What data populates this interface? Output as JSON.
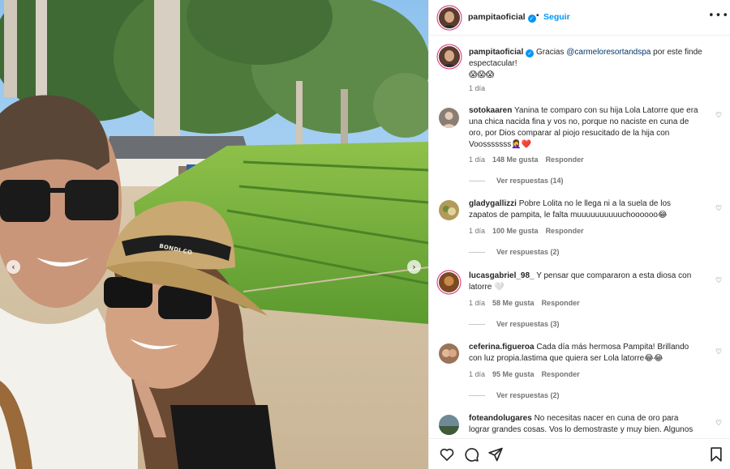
{
  "post": {
    "username": "pampitaoficial",
    "separator": "•",
    "follow_label": "Seguir",
    "more_label": "•••",
    "hat_text": "BONDI CO",
    "prev_label": "‹",
    "next_label": "›"
  },
  "caption": {
    "username": "pampitaoficial",
    "text_before": "Gracias ",
    "mention": "@carmeloresortandspa",
    "text_after": " por este finde espectacular!",
    "emojis": "😱😱😱",
    "time": "1 día"
  },
  "comments": [
    {
      "username": "sotokaaren",
      "text": "Yanina te comparo con su hija Lola Latorre que era una chica nacida fina y vos no, porque no naciste en cuna de oro, por Dios comparar al piojo resucitado de la hija con Voosssssss🤦‍♀️❤️",
      "time": "1 día",
      "likes": "148 Me gusta",
      "reply": "Responder",
      "replies": "Ver respuestas (14)",
      "avatar_color": "#8a7e74"
    },
    {
      "username": "gladygallizzi",
      "text": "Pobre Lolita no le llega ni a la suela de los zapatos de pampita, le falta muuuuuuuuuuchoooooo😂",
      "time": "1 día",
      "likes": "100 Me gusta",
      "reply": "Responder",
      "replies": "Ver respuestas (2)",
      "avatar_color": "#b19a5a"
    },
    {
      "username": "lucasgabriel_98_",
      "text": "Y pensar que compararon a esta diosa con latorre 🤍",
      "time": "1 día",
      "likes": "58 Me gusta",
      "reply": "Responder",
      "replies": "Ver respuestas (3)",
      "avatar_color": "#7b4a22"
    },
    {
      "username": "ceferina.figueroa",
      "text": "Cada día más hermosa Pampita! Brillando con luz propia.lastima que quiera ser Lola latorre😂😂",
      "time": "1 día",
      "likes": "95 Me gusta",
      "reply": "Responder",
      "replies": "Ver respuestas (2)",
      "avatar_color": "#9b7358"
    },
    {
      "username": "foteandolugares",
      "text": "No necesitas nacer en cuna de oro para lograr grandes cosas. Vos lo demostraste y muy bien. Algunos",
      "avatar_color": "#6f8a96"
    }
  ],
  "actions": {
    "like_icon": "heart-icon",
    "comment_icon": "comment-icon",
    "share_icon": "share-icon",
    "save_icon": "bookmark-icon",
    "heart_glyph": "♡"
  },
  "colors": {
    "accent": "#0095f6",
    "mention": "#00376b",
    "muted": "#737373",
    "text": "#262626"
  }
}
